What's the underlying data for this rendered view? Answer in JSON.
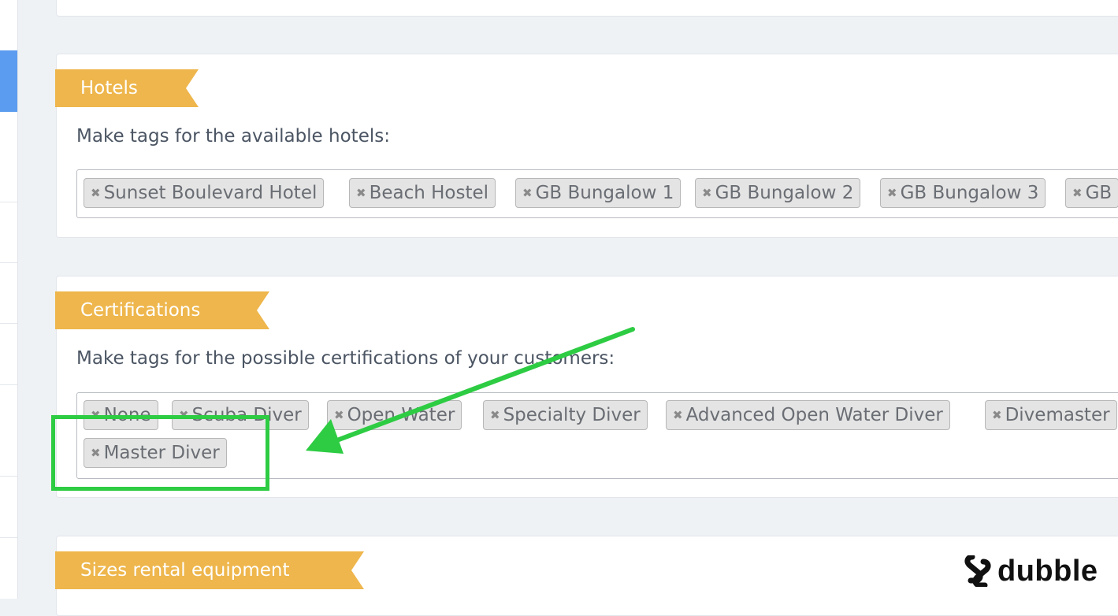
{
  "sections": {
    "hotels": {
      "title": "Hotels",
      "description": "Make tags for the available hotels:",
      "tags": [
        "Sunset Boulevard Hotel",
        "Beach Hostel",
        "GB Bungalow 1",
        "GB Bungalow 2",
        "GB Bungalow 3",
        "GB"
      ]
    },
    "certifications": {
      "title": "Certifications",
      "description": "Make tags for the possible certifications of your customers:",
      "tags": [
        "None",
        "Scuba Diver",
        "Open Water",
        "Specialty Diver",
        "Advanced Open Water Diver",
        "Divemaster",
        "Master Diver"
      ]
    },
    "sizes": {
      "title": "Sizes rental equipment"
    }
  },
  "tag_remove_symbol": "✖",
  "branding": {
    "logo_text": "dubble"
  },
  "colors": {
    "ribbon": "#eeb64c",
    "annotation": "#2dcc43",
    "sidebar_active": "#5b9cf0",
    "page_background": "#eef2f5"
  }
}
